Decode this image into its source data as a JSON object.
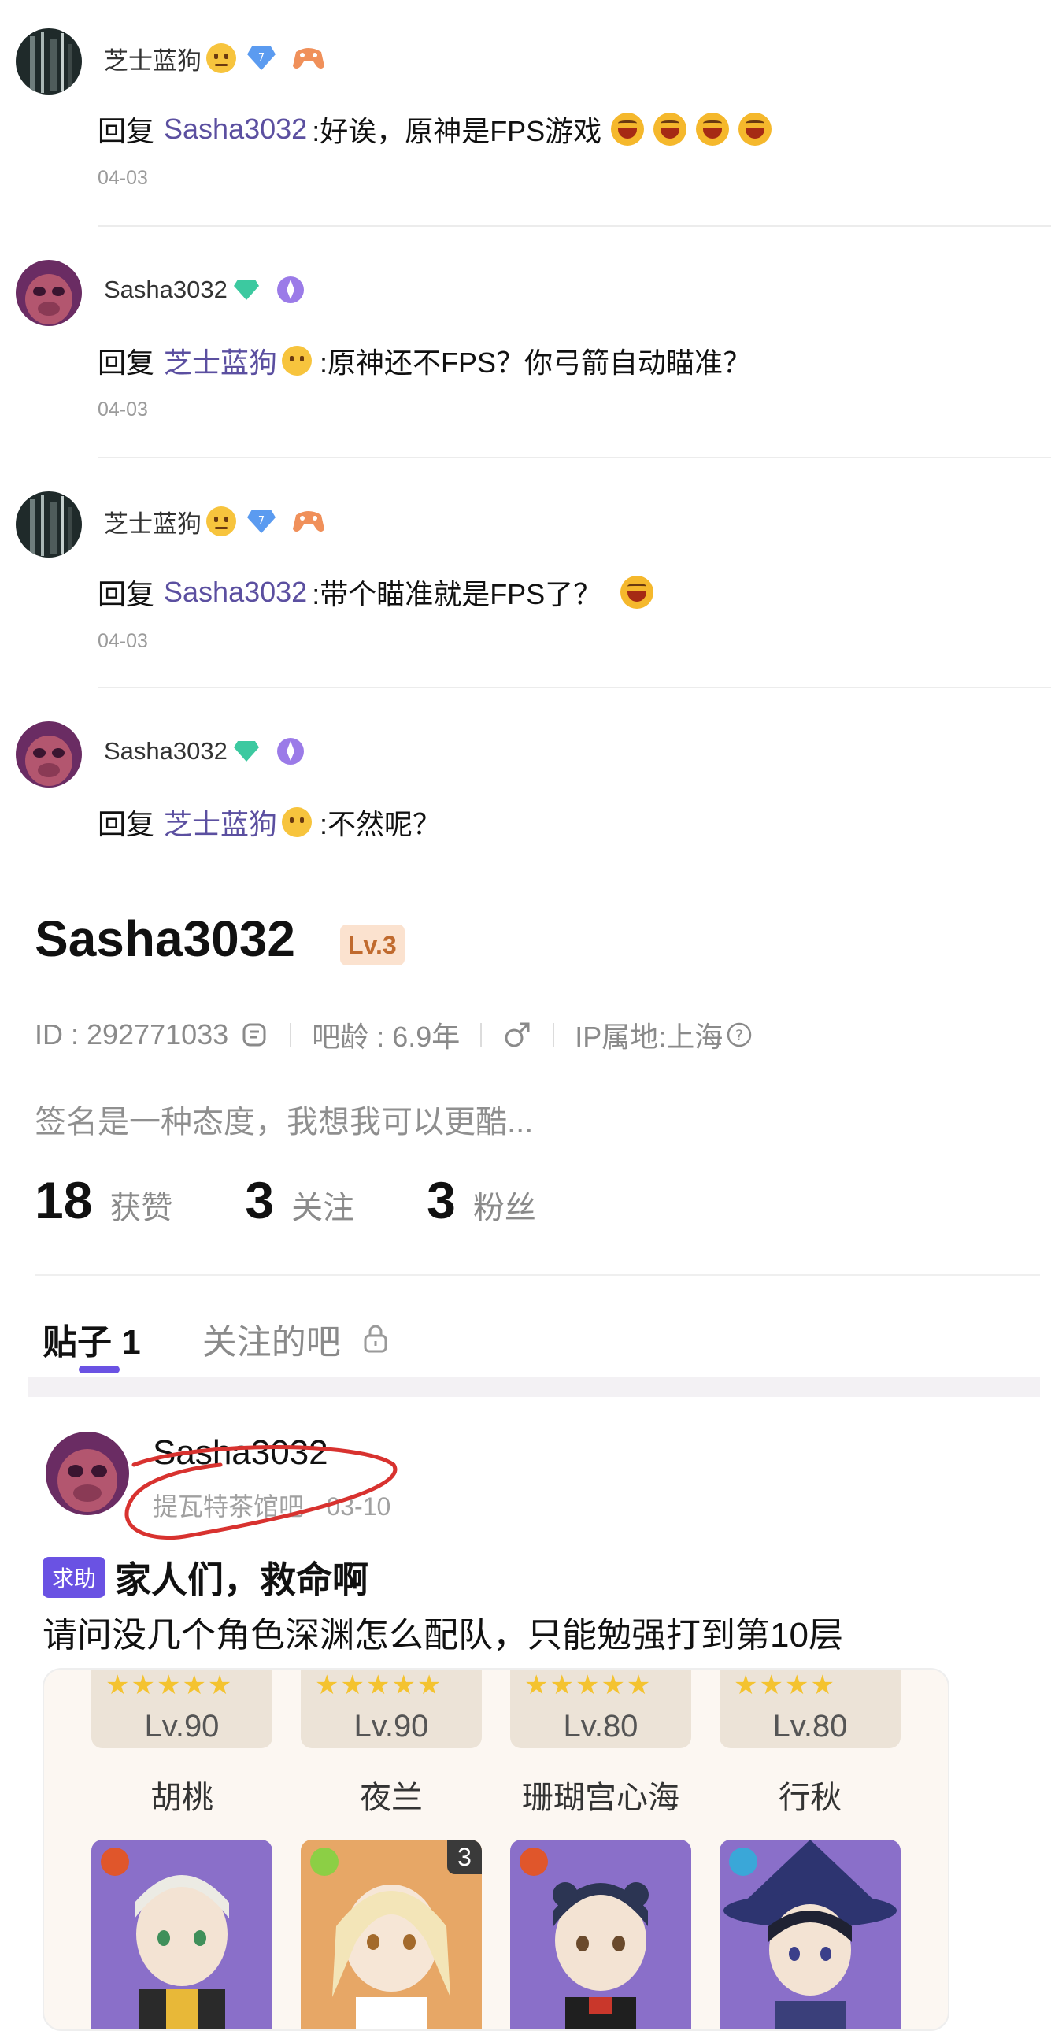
{
  "replies": [
    {
      "username": "芝士蓝狗",
      "level_badge": "7",
      "reply_label": "回复",
      "mention": "Sasha3032",
      "text": ":好诶，原神是FPS游戏",
      "date": "04-03"
    },
    {
      "username": "Sasha3032",
      "reply_label": "回复",
      "mention": "芝士蓝狗",
      "text": ":原神还不FPS？你弓箭自动瞄准？",
      "date": "04-03"
    },
    {
      "username": "芝士蓝狗",
      "level_badge": "7",
      "reply_label": "回复",
      "mention": "Sasha3032",
      "text": ":带个瞄准就是FPS了？",
      "date": "04-03"
    },
    {
      "username": "Sasha3032",
      "reply_label": "回复",
      "mention": "芝士蓝狗",
      "text": ":不然呢？"
    }
  ],
  "profile": {
    "name": "Sasha3032",
    "level": "Lv.3",
    "id": "ID : 292771033",
    "age": "吧龄 : 6.9年",
    "ip": "IP属地:上海",
    "signature": "签名是一种态度，我想我可以更酷...",
    "stats": [
      {
        "num": "18",
        "label": "获赞"
      },
      {
        "num": "3",
        "label": "关注"
      },
      {
        "num": "3",
        "label": "粉丝"
      }
    ]
  },
  "tabs": {
    "posts": "贴子 1",
    "followed_bars": "关注的吧"
  },
  "post": {
    "author": "Sasha3032",
    "sub": "提瓦特茶馆吧 · 03-10",
    "tag": "求助",
    "title": "家人们，救命啊",
    "body": "请问没几个角色深渊怎么配队，只能勉强打到第10层",
    "characters": [
      {
        "name": "胡桃",
        "level": "Lv.90",
        "stars": "★★★★★"
      },
      {
        "name": "夜兰",
        "level": "Lv.90",
        "stars": "★★★★★"
      },
      {
        "name": "珊瑚宫心海",
        "level": "Lv.80",
        "stars": "★★★★★"
      },
      {
        "name": "行秋",
        "level": "Lv.80",
        "stars": "★★★★"
      }
    ],
    "constellation": "3"
  }
}
